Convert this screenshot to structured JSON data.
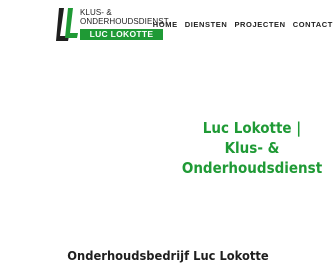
{
  "brand": {
    "line1": "KLUS- &",
    "line2": "ONDERHOUDSDIENST",
    "name": "LUC LOKOTTE",
    "accent_color": "#1f9a35",
    "mark_icon": "ll-logo-icon"
  },
  "nav": {
    "items": [
      {
        "label": "HOME"
      },
      {
        "label": "DIENSTEN"
      },
      {
        "label": "PROJECTEN"
      },
      {
        "label": "CONTACT"
      }
    ]
  },
  "hero": {
    "title": "Luc Lokotte |\nKlus- &\nOnderhoudsdienst"
  },
  "section": {
    "title": "Onderhoudsbedrijf Luc Lokotte"
  }
}
